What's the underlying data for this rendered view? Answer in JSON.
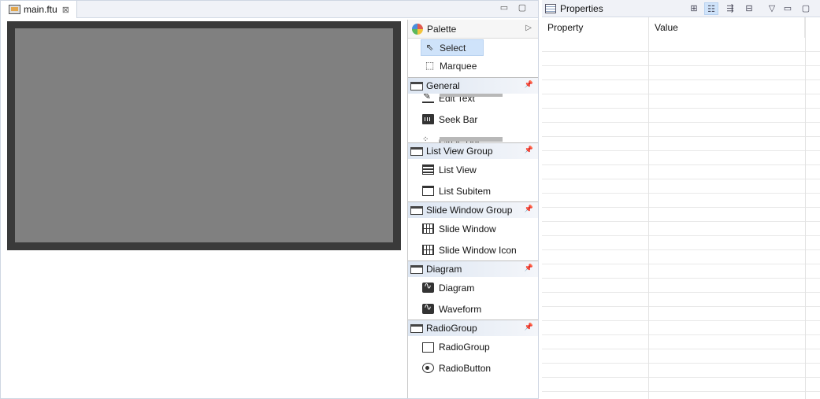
{
  "editor": {
    "tab_title": "main.ftu",
    "tab_close": "⊠",
    "minimize": "▭",
    "maximize": "▢"
  },
  "palette": {
    "title": "Palette",
    "arrow": "▷",
    "tools": [
      {
        "label": "Select",
        "icon": "arrow-cursor-icon",
        "selected": true
      },
      {
        "label": "Marquee",
        "icon": "marquee-icon",
        "selected": false
      }
    ],
    "drawers": [
      {
        "title": "General",
        "items": [
          "Edit Text",
          "Seek Bar",
          "Circle Bar"
        ]
      },
      {
        "title": "List View Group",
        "items": [
          "List View",
          "List Subitem"
        ]
      },
      {
        "title": "Slide Window Group",
        "items": [
          "Slide Window",
          "Slide Window Icon"
        ]
      },
      {
        "title": "Diagram",
        "items": [
          "Diagram",
          "Waveform"
        ]
      },
      {
        "title": "RadioGroup",
        "items": [
          "RadioGroup",
          "RadioButton"
        ]
      }
    ],
    "pin": "📌"
  },
  "properties": {
    "title": "Properties",
    "columns": [
      "Property",
      "Value"
    ],
    "toolbar_icons": [
      "new-property-icon",
      "categories-icon",
      "filter-icon",
      "restore-default-icon",
      "view-menu-icon",
      "minimize-icon",
      "maximize-icon"
    ],
    "toolbar_glyphs": [
      "⊞",
      "☷",
      "⇶",
      "⊟",
      "▽",
      "▭",
      "▢"
    ]
  },
  "colors": {
    "canvas_frame": "#3a3a3a",
    "canvas": "#808080",
    "selection": "#cfe3fa"
  }
}
